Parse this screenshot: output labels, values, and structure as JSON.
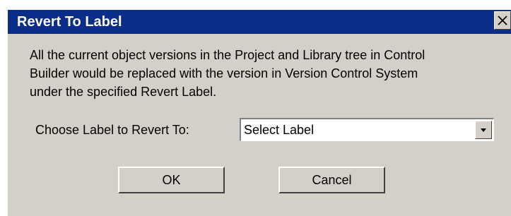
{
  "dialog": {
    "title": "Revert To Label",
    "close_icon": "close-icon",
    "message_lines": [
      "All the current object versions in the Project and Library tree in Control",
      "Builder would be replaced with the version in Version Control System",
      "under the specified Revert Label."
    ],
    "choose_label": "Choose Label to Revert To:",
    "select": {
      "value": "Select Label",
      "arrow_icon": "dropdown-arrow-icon"
    },
    "buttons": {
      "ok_label": "OK",
      "cancel_label": "Cancel"
    }
  },
  "colors": {
    "titlebar": "#0a2d89",
    "dialog_background": "#d4d0c8",
    "title_text": "#ffffff"
  }
}
